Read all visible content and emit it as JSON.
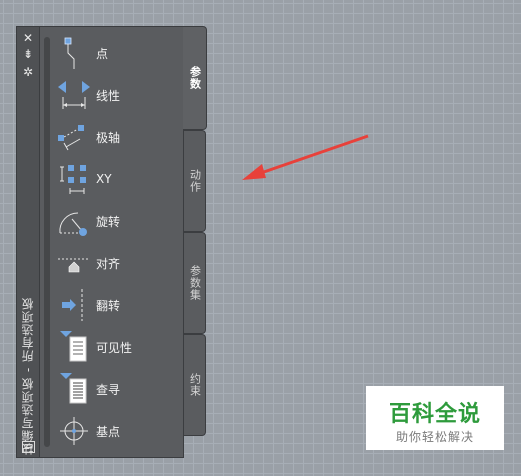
{
  "window": {
    "title": "块编写选项板 - 所有选项板",
    "buttons": {
      "close": "✕",
      "autohide": "⇟",
      "properties": "✲"
    }
  },
  "palette": {
    "items": [
      {
        "label": "点",
        "icon": "point-parameter-icon"
      },
      {
        "label": "线性",
        "icon": "linear-parameter-icon"
      },
      {
        "label": "极轴",
        "icon": "polar-parameter-icon"
      },
      {
        "label": "XY",
        "icon": "xy-parameter-icon"
      },
      {
        "label": "旋转",
        "icon": "rotation-parameter-icon"
      },
      {
        "label": "对齐",
        "icon": "alignment-parameter-icon"
      },
      {
        "label": "翻转",
        "icon": "flip-parameter-icon"
      },
      {
        "label": "可见性",
        "icon": "visibility-parameter-icon"
      },
      {
        "label": "查寻",
        "icon": "lookup-parameter-icon"
      },
      {
        "label": "基点",
        "icon": "basepoint-parameter-icon"
      }
    ]
  },
  "tabs": [
    {
      "label": "参数",
      "active": true
    },
    {
      "label": "动作",
      "active": false
    },
    {
      "label": "参数集",
      "active": false
    },
    {
      "label": "约束",
      "active": false
    }
  ],
  "annotation": {
    "arrow_color": "#e8413a"
  },
  "watermark": {
    "main": "百科全说",
    "sub": "助你轻松解决"
  }
}
